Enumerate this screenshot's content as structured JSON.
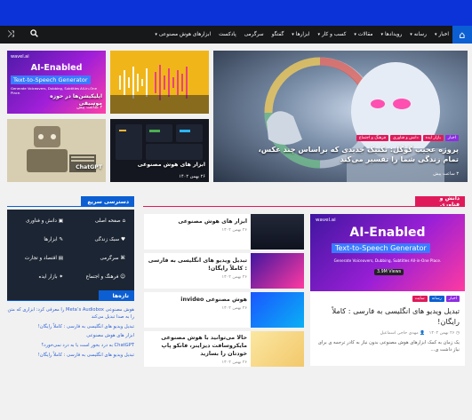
{
  "nav": {
    "items": [
      {
        "label": "اخبار",
        "caret": true
      },
      {
        "label": "رسانه",
        "caret": true
      },
      {
        "label": "رویدادها",
        "caret": true
      },
      {
        "label": "مقالات",
        "caret": true
      },
      {
        "label": "کسب و کار",
        "caret": true
      },
      {
        "label": "ابزارها",
        "caret": true
      },
      {
        "label": "گفتگو",
        "caret": false
      },
      {
        "label": "سرگرمی",
        "caret": false
      },
      {
        "label": "پادکست",
        "caret": false
      },
      {
        "label": "ابزارهای هوش مصنوعی",
        "caret": true
      }
    ],
    "icons": {
      "home": "home-icon",
      "search": "search-icon",
      "shuffle": "shuffle-icon"
    }
  },
  "hero": {
    "main": {
      "title": "پروژه عجیب گوگل: تکنیک جدیدی که براساس چند عکس، تمام زندگی شما را تفسیر می‌کند",
      "badges": [
        "اخبار",
        "بازار ایده",
        "دانش و فناوری",
        "فرهنگ و اجتماع"
      ],
      "meta": "۳ ساعت پیش"
    },
    "tile1": {
      "title": "اپلیکیشن‌ها در حوزه موسیقی",
      "meta": "۳ ساعت پیش",
      "img_text1": "wavel.ai",
      "img_text2": "AI-Enabled",
      "img_text3": "Text-to-Speech Generator",
      "img_text4": "Generate Voiceovers, Dubbing, Subtitles All-in-One Place."
    },
    "tile2": {
      "title": "",
      "meta": ""
    },
    "tile3": {
      "title": "ابزار های هوش مصنوعی",
      "meta": "۲۶ بهمن ۱۴۰۲"
    },
    "tile4": {
      "title": "ChatGPT",
      "meta": ""
    }
  },
  "sections": {
    "tech": {
      "title": "دانش و فناوری",
      "color": "#e01a5a"
    },
    "quick": {
      "title": "دسترسی سریع",
      "color": "#0b5fd3"
    },
    "latest": {
      "title": "تازه‌ها",
      "color": "#0b5fd3"
    }
  },
  "featured": {
    "image_brand": "wavel.ai",
    "image_line1": "AI-Enabled",
    "image_line2": "Text-to-Speech Generator",
    "image_line3": "Generate Voiceovers, Dubbing, Subtitles All-in-One Place.",
    "image_views": "3.9M Views",
    "badges": [
      "اخبار",
      "رسانه",
      "سایت"
    ],
    "title": "تبدیل ویدیو های انگلیسی به فارسی : کاملاً رایگان!",
    "meta_author": "مهدی حاجی اسماعیل",
    "meta_date": "۲۶ بهمن ۱۴۰۲",
    "excerpt": "یک زمان به کمک ابزارهای هوش مصنوعی بدون نیاز به کادر ترجمه ی برای نیاز داشت ی..."
  },
  "list": [
    {
      "title": "ابزار های هوش مصنوعی",
      "meta": "۲۶ بهمن ۱۴۰۲"
    },
    {
      "title": "تبدیل ویدیو های انگلیسی به فارسی : کاملاً رایگان!",
      "meta": "۲۶ بهمن ۱۴۰۲"
    },
    {
      "title": "هوش مصنوعی invideo",
      "meta": "۲۶ بهمن ۱۴۰۲"
    },
    {
      "title": "حالا می‌توانید با هوش مصنوعی مایکروسافت دیزاینر، فانکو پاپ خودتان را بسازید",
      "meta": "۲۶ بهمن ۱۴۰۲"
    }
  ],
  "quick_links": [
    {
      "label": "دانش و فناوری",
      "icon": "chip-icon"
    },
    {
      "label": "صفحه اصلی",
      "icon": "home-icon"
    },
    {
      "label": "اقتصاد و تجارت",
      "icon": "chart-icon"
    },
    {
      "label": "سبک زندگی",
      "icon": "heart-icon"
    },
    {
      "label": "سرگرمی",
      "icon": "gamepad-icon"
    },
    {
      "label": "ابزارها",
      "icon": "tools-icon"
    },
    {
      "label": "بازار ایده",
      "icon": "idea-icon"
    },
    {
      "label": "فرهنگ و اجتماع",
      "icon": "people-icon"
    }
  ],
  "latest": [
    "هوش مصنوعی Meta’s Audiobox را معرفی کرد: ابزاری که متن را به صدا تبدیل می‌کند",
    "تبدیل ویدیو های انگلیسی به فارسی : کاملاً رایگان!",
    "ابزار های هوش مصنوعی",
    "ChatGPT به درد بخور است یا به درد نمی‌خورد؟",
    "تبدیل ویدیو های انگلیسی به فارسی : کاملاً رایگان!"
  ]
}
